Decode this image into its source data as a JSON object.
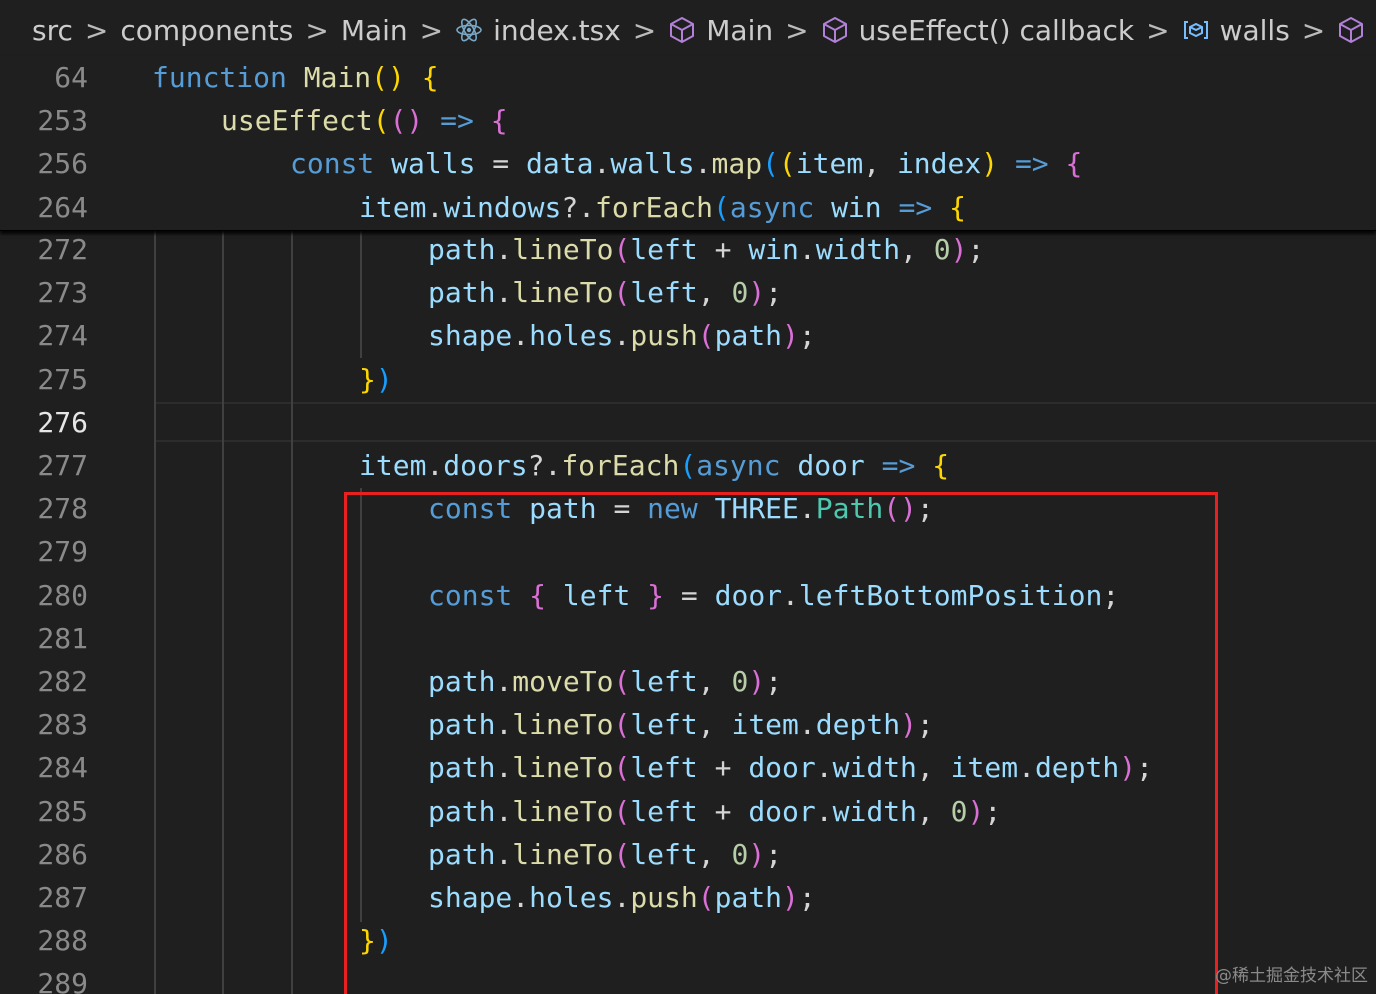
{
  "breadcrumb": {
    "items": [
      {
        "label": "src",
        "icon": ""
      },
      {
        "label": "components",
        "icon": ""
      },
      {
        "label": "Main",
        "icon": ""
      },
      {
        "label": "index.tsx",
        "icon": "react-icon"
      },
      {
        "label": "Main",
        "icon": "cube-icon"
      },
      {
        "label": "useEffect() callback",
        "icon": "cube-icon"
      },
      {
        "label": "walls",
        "icon": "variable-icon"
      }
    ],
    "separator": ">"
  },
  "colors": {
    "background": "#1f1f1f",
    "keyword": "#569cd6",
    "function": "#dcdcaa",
    "variable": "#9cdcfe",
    "class": "#4ec9b0",
    "number": "#b5cea8",
    "bracket_level1": "#ffd700",
    "bracket_level2": "#da70d6",
    "bracket_level3": "#179fff",
    "highlight_box": "#e8201f"
  },
  "editor": {
    "active_line": 276,
    "sticky_lines": [
      {
        "num": "64",
        "tokens": [
          {
            "t": "function",
            "c": "kw"
          },
          {
            "t": " ",
            "c": "pl"
          },
          {
            "t": "Main",
            "c": "fn"
          },
          {
            "t": "()",
            "c": "b1"
          },
          {
            "t": " ",
            "c": "pl"
          },
          {
            "t": "{",
            "c": "b1"
          }
        ]
      },
      {
        "num": "253",
        "tokens": [
          {
            "t": "useEffect",
            "c": "fn"
          },
          {
            "t": "(",
            "c": "b1"
          },
          {
            "t": "()",
            "c": "b2"
          },
          {
            "t": " ",
            "c": "pl"
          },
          {
            "t": "=>",
            "c": "kw"
          },
          {
            "t": " ",
            "c": "pl"
          },
          {
            "t": "{",
            "c": "b2"
          }
        ]
      },
      {
        "num": "256",
        "tokens": [
          {
            "t": "const",
            "c": "kw"
          },
          {
            "t": " ",
            "c": "pl"
          },
          {
            "t": "walls",
            "c": "var"
          },
          {
            "t": " = ",
            "c": "pl"
          },
          {
            "t": "data",
            "c": "var"
          },
          {
            "t": ".",
            "c": "pl"
          },
          {
            "t": "walls",
            "c": "var"
          },
          {
            "t": ".",
            "c": "pl"
          },
          {
            "t": "map",
            "c": "fn"
          },
          {
            "t": "(",
            "c": "b3"
          },
          {
            "t": "(",
            "c": "b1"
          },
          {
            "t": "item",
            "c": "var"
          },
          {
            "t": ", ",
            "c": "pl"
          },
          {
            "t": "index",
            "c": "var"
          },
          {
            "t": ")",
            "c": "b1"
          },
          {
            "t": " ",
            "c": "pl"
          },
          {
            "t": "=>",
            "c": "kw"
          },
          {
            "t": " ",
            "c": "pl"
          },
          {
            "t": "{",
            "c": "b2"
          }
        ]
      },
      {
        "num": "264",
        "tokens": [
          {
            "t": "item",
            "c": "var"
          },
          {
            "t": ".",
            "c": "pl"
          },
          {
            "t": "windows",
            "c": "var"
          },
          {
            "t": "?.",
            "c": "pl"
          },
          {
            "t": "forEach",
            "c": "fn"
          },
          {
            "t": "(",
            "c": "b3"
          },
          {
            "t": "async",
            "c": "kw"
          },
          {
            "t": " ",
            "c": "pl"
          },
          {
            "t": "win",
            "c": "var"
          },
          {
            "t": " ",
            "c": "pl"
          },
          {
            "t": "=>",
            "c": "kw"
          },
          {
            "t": " ",
            "c": "pl"
          },
          {
            "t": "{",
            "c": "b1"
          }
        ]
      }
    ],
    "lines": [
      {
        "num": "272",
        "tokens": [
          {
            "t": "path",
            "c": "var"
          },
          {
            "t": ".",
            "c": "pl"
          },
          {
            "t": "lineTo",
            "c": "fn"
          },
          {
            "t": "(",
            "c": "b2"
          },
          {
            "t": "left",
            "c": "var"
          },
          {
            "t": " + ",
            "c": "pl"
          },
          {
            "t": "win",
            "c": "var"
          },
          {
            "t": ".",
            "c": "pl"
          },
          {
            "t": "width",
            "c": "var"
          },
          {
            "t": ", ",
            "c": "pl"
          },
          {
            "t": "0",
            "c": "num"
          },
          {
            "t": ")",
            "c": "b2"
          },
          {
            "t": ";",
            "c": "pl"
          }
        ]
      },
      {
        "num": "273",
        "tokens": [
          {
            "t": "path",
            "c": "var"
          },
          {
            "t": ".",
            "c": "pl"
          },
          {
            "t": "lineTo",
            "c": "fn"
          },
          {
            "t": "(",
            "c": "b2"
          },
          {
            "t": "left",
            "c": "var"
          },
          {
            "t": ", ",
            "c": "pl"
          },
          {
            "t": "0",
            "c": "num"
          },
          {
            "t": ")",
            "c": "b2"
          },
          {
            "t": ";",
            "c": "pl"
          }
        ]
      },
      {
        "num": "274",
        "tokens": [
          {
            "t": "shape",
            "c": "var"
          },
          {
            "t": ".",
            "c": "pl"
          },
          {
            "t": "holes",
            "c": "var"
          },
          {
            "t": ".",
            "c": "pl"
          },
          {
            "t": "push",
            "c": "fn"
          },
          {
            "t": "(",
            "c": "b2"
          },
          {
            "t": "path",
            "c": "var"
          },
          {
            "t": ")",
            "c": "b2"
          },
          {
            "t": ";",
            "c": "pl"
          }
        ]
      },
      {
        "num": "275",
        "tokens": [
          {
            "t": "}",
            "c": "b1"
          },
          {
            "t": ")",
            "c": "b3"
          }
        ]
      },
      {
        "num": "276",
        "tokens": []
      },
      {
        "num": "277",
        "tokens": [
          {
            "t": "item",
            "c": "var"
          },
          {
            "t": ".",
            "c": "pl"
          },
          {
            "t": "doors",
            "c": "var"
          },
          {
            "t": "?.",
            "c": "pl"
          },
          {
            "t": "forEach",
            "c": "fn"
          },
          {
            "t": "(",
            "c": "b3"
          },
          {
            "t": "async",
            "c": "kw"
          },
          {
            "t": " ",
            "c": "pl"
          },
          {
            "t": "door",
            "c": "var"
          },
          {
            "t": " ",
            "c": "pl"
          },
          {
            "t": "=>",
            "c": "kw"
          },
          {
            "t": " ",
            "c": "pl"
          },
          {
            "t": "{",
            "c": "b1"
          }
        ]
      },
      {
        "num": "278",
        "tokens": [
          {
            "t": "const",
            "c": "kw"
          },
          {
            "t": " ",
            "c": "pl"
          },
          {
            "t": "path",
            "c": "var"
          },
          {
            "t": " = ",
            "c": "pl"
          },
          {
            "t": "new",
            "c": "kw"
          },
          {
            "t": " ",
            "c": "pl"
          },
          {
            "t": "THREE",
            "c": "var"
          },
          {
            "t": ".",
            "c": "pl"
          },
          {
            "t": "Path",
            "c": "cls"
          },
          {
            "t": "()",
            "c": "b2"
          },
          {
            "t": ";",
            "c": "pl"
          }
        ]
      },
      {
        "num": "279",
        "tokens": []
      },
      {
        "num": "280",
        "tokens": [
          {
            "t": "const",
            "c": "kw"
          },
          {
            "t": " ",
            "c": "pl"
          },
          {
            "t": "{",
            "c": "b2"
          },
          {
            "t": " ",
            "c": "pl"
          },
          {
            "t": "left",
            "c": "var"
          },
          {
            "t": " ",
            "c": "pl"
          },
          {
            "t": "}",
            "c": "b2"
          },
          {
            "t": " = ",
            "c": "pl"
          },
          {
            "t": "door",
            "c": "var"
          },
          {
            "t": ".",
            "c": "pl"
          },
          {
            "t": "leftBottomPosition",
            "c": "var"
          },
          {
            "t": ";",
            "c": "pl"
          }
        ]
      },
      {
        "num": "281",
        "tokens": []
      },
      {
        "num": "282",
        "tokens": [
          {
            "t": "path",
            "c": "var"
          },
          {
            "t": ".",
            "c": "pl"
          },
          {
            "t": "moveTo",
            "c": "fn"
          },
          {
            "t": "(",
            "c": "b2"
          },
          {
            "t": "left",
            "c": "var"
          },
          {
            "t": ", ",
            "c": "pl"
          },
          {
            "t": "0",
            "c": "num"
          },
          {
            "t": ")",
            "c": "b2"
          },
          {
            "t": ";",
            "c": "pl"
          }
        ]
      },
      {
        "num": "283",
        "tokens": [
          {
            "t": "path",
            "c": "var"
          },
          {
            "t": ".",
            "c": "pl"
          },
          {
            "t": "lineTo",
            "c": "fn"
          },
          {
            "t": "(",
            "c": "b2"
          },
          {
            "t": "left",
            "c": "var"
          },
          {
            "t": ", ",
            "c": "pl"
          },
          {
            "t": "item",
            "c": "var"
          },
          {
            "t": ".",
            "c": "pl"
          },
          {
            "t": "depth",
            "c": "var"
          },
          {
            "t": ")",
            "c": "b2"
          },
          {
            "t": ";",
            "c": "pl"
          }
        ]
      },
      {
        "num": "284",
        "tokens": [
          {
            "t": "path",
            "c": "var"
          },
          {
            "t": ".",
            "c": "pl"
          },
          {
            "t": "lineTo",
            "c": "fn"
          },
          {
            "t": "(",
            "c": "b2"
          },
          {
            "t": "left",
            "c": "var"
          },
          {
            "t": " + ",
            "c": "pl"
          },
          {
            "t": "door",
            "c": "var"
          },
          {
            "t": ".",
            "c": "pl"
          },
          {
            "t": "width",
            "c": "var"
          },
          {
            "t": ", ",
            "c": "pl"
          },
          {
            "t": "item",
            "c": "var"
          },
          {
            "t": ".",
            "c": "pl"
          },
          {
            "t": "depth",
            "c": "var"
          },
          {
            "t": ")",
            "c": "b2"
          },
          {
            "t": ";",
            "c": "pl"
          }
        ]
      },
      {
        "num": "285",
        "tokens": [
          {
            "t": "path",
            "c": "var"
          },
          {
            "t": ".",
            "c": "pl"
          },
          {
            "t": "lineTo",
            "c": "fn"
          },
          {
            "t": "(",
            "c": "b2"
          },
          {
            "t": "left",
            "c": "var"
          },
          {
            "t": " + ",
            "c": "pl"
          },
          {
            "t": "door",
            "c": "var"
          },
          {
            "t": ".",
            "c": "pl"
          },
          {
            "t": "width",
            "c": "var"
          },
          {
            "t": ", ",
            "c": "pl"
          },
          {
            "t": "0",
            "c": "num"
          },
          {
            "t": ")",
            "c": "b2"
          },
          {
            "t": ";",
            "c": "pl"
          }
        ]
      },
      {
        "num": "286",
        "tokens": [
          {
            "t": "path",
            "c": "var"
          },
          {
            "t": ".",
            "c": "pl"
          },
          {
            "t": "lineTo",
            "c": "fn"
          },
          {
            "t": "(",
            "c": "b2"
          },
          {
            "t": "left",
            "c": "var"
          },
          {
            "t": ", ",
            "c": "pl"
          },
          {
            "t": "0",
            "c": "num"
          },
          {
            "t": ")",
            "c": "b2"
          },
          {
            "t": ";",
            "c": "pl"
          }
        ]
      },
      {
        "num": "287",
        "tokens": [
          {
            "t": "shape",
            "c": "var"
          },
          {
            "t": ".",
            "c": "pl"
          },
          {
            "t": "holes",
            "c": "var"
          },
          {
            "t": ".",
            "c": "pl"
          },
          {
            "t": "push",
            "c": "fn"
          },
          {
            "t": "(",
            "c": "b2"
          },
          {
            "t": "path",
            "c": "var"
          },
          {
            "t": ")",
            "c": "b2"
          },
          {
            "t": ";",
            "c": "pl"
          }
        ]
      },
      {
        "num": "288",
        "tokens": [
          {
            "t": "}",
            "c": "b1"
          },
          {
            "t": ")",
            "c": "b3"
          }
        ]
      },
      {
        "num": "289",
        "tokens": []
      }
    ]
  },
  "watermark": "@稀土掘金技术社区"
}
